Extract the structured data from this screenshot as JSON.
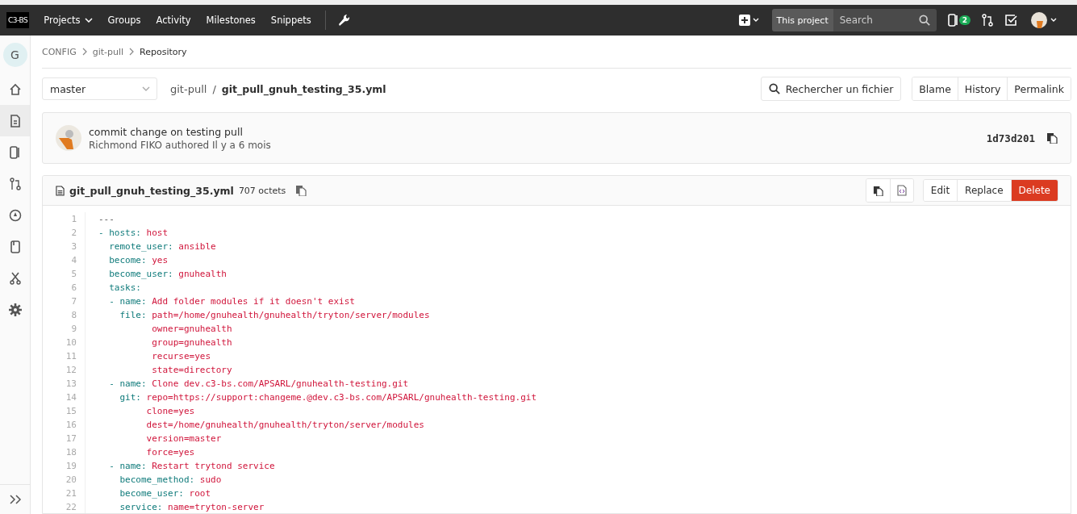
{
  "header": {
    "logo": "C3-BS",
    "nav": [
      {
        "label": "Projects",
        "dropdown": true
      },
      {
        "label": "Groups",
        "dropdown": false
      },
      {
        "label": "Activity",
        "dropdown": false
      },
      {
        "label": "Milestones",
        "dropdown": false
      },
      {
        "label": "Snippets",
        "dropdown": false
      }
    ],
    "search_scope": "This project",
    "search": {
      "placeholder": "Search"
    },
    "issues_badge": "2"
  },
  "sidebar": {
    "avatar": "G",
    "items": [
      {
        "selected": false
      },
      {
        "selected": true
      },
      {
        "selected": false
      },
      {
        "selected": false
      },
      {
        "selected": false
      },
      {
        "selected": false
      },
      {
        "selected": false
      },
      {
        "selected": false
      }
    ]
  },
  "breadcrumbs": [
    {
      "label": "CONFIG",
      "current": false
    },
    {
      "label": "git-pull",
      "current": false
    },
    {
      "label": "Repository",
      "current": true
    }
  ],
  "branch": "master",
  "path": {
    "project": "git-pull",
    "sep": "/",
    "file": "git_pull_gnuh_testing_35.yml"
  },
  "find_file": "Rechercher un fichier",
  "view_buttons": [
    "Blame",
    "History",
    "Permalink"
  ],
  "commit": {
    "message": "commit change on testing pull",
    "author": "Richmond FIKO authored Il y a 6 mois",
    "sha": "1d73d201"
  },
  "file": {
    "name": "git_pull_gnuh_testing_35.yml",
    "size": "707 octets",
    "actions": [
      {
        "label": "Edit",
        "kind": "default"
      },
      {
        "label": "Replace",
        "kind": "default"
      },
      {
        "label": "Delete",
        "kind": "danger"
      }
    ]
  },
  "code": [
    {
      "n": "1",
      "parts": [
        {
          "kind": "plain",
          "text": "---"
        }
      ]
    },
    {
      "n": "2",
      "parts": [
        {
          "kind": "key",
          "text": "- hosts:"
        },
        {
          "kind": "value",
          "text": " host"
        }
      ]
    },
    {
      "n": "3",
      "parts": [
        {
          "kind": "key",
          "text": "  remote_user:"
        },
        {
          "kind": "value",
          "text": " ansible"
        }
      ]
    },
    {
      "n": "4",
      "parts": [
        {
          "kind": "key",
          "text": "  become:"
        },
        {
          "kind": "value",
          "text": " yes"
        }
      ]
    },
    {
      "n": "5",
      "parts": [
        {
          "kind": "key",
          "text": "  become_user:"
        },
        {
          "kind": "value",
          "text": " gnuhealth"
        }
      ]
    },
    {
      "n": "6",
      "parts": [
        {
          "kind": "key",
          "text": "  tasks:"
        }
      ]
    },
    {
      "n": "7",
      "parts": [
        {
          "kind": "key",
          "text": "  - name:"
        },
        {
          "kind": "value",
          "text": " Add folder modules if it doesn't exist"
        }
      ]
    },
    {
      "n": "8",
      "parts": [
        {
          "kind": "key",
          "text": "    file:"
        },
        {
          "kind": "value",
          "text": " path=/home/gnuhealth/gnuhealth/tryton/server/modules"
        }
      ]
    },
    {
      "n": "9",
      "parts": [
        {
          "kind": "value",
          "text": "          owner=gnuhealth"
        }
      ]
    },
    {
      "n": "10",
      "parts": [
        {
          "kind": "value",
          "text": "          group=gnuhealth"
        }
      ]
    },
    {
      "n": "11",
      "parts": [
        {
          "kind": "value",
          "text": "          recurse=yes"
        }
      ]
    },
    {
      "n": "12",
      "parts": [
        {
          "kind": "value",
          "text": "          state=directory"
        }
      ]
    },
    {
      "n": "13",
      "parts": [
        {
          "kind": "key",
          "text": "  - name:"
        },
        {
          "kind": "value",
          "text": " Clone dev.c3-bs.com/APSARL/gnuhealth-testing.git"
        }
      ]
    },
    {
      "n": "14",
      "parts": [
        {
          "kind": "key",
          "text": "    git:"
        },
        {
          "kind": "value",
          "text": " repo=https://support:changeme.@dev.c3-bs.com/APSARL/gnuhealth-testing.git"
        }
      ]
    },
    {
      "n": "15",
      "parts": [
        {
          "kind": "value",
          "text": "         clone=yes"
        }
      ]
    },
    {
      "n": "16",
      "parts": [
        {
          "kind": "value",
          "text": "         dest=/home/gnuhealth/gnuhealth/tryton/server/modules"
        }
      ]
    },
    {
      "n": "17",
      "parts": [
        {
          "kind": "value",
          "text": "         version=master"
        }
      ]
    },
    {
      "n": "18",
      "parts": [
        {
          "kind": "value",
          "text": "         force=yes"
        }
      ]
    },
    {
      "n": "19",
      "parts": [
        {
          "kind": "key",
          "text": "  - name:"
        },
        {
          "kind": "value",
          "text": " Restart trytond service"
        }
      ]
    },
    {
      "n": "20",
      "parts": [
        {
          "kind": "key",
          "text": "    become_method:"
        },
        {
          "kind": "value",
          "text": " sudo"
        }
      ]
    },
    {
      "n": "21",
      "parts": [
        {
          "kind": "key",
          "text": "    become_user:"
        },
        {
          "kind": "value",
          "text": " root"
        }
      ]
    },
    {
      "n": "22",
      "parts": [
        {
          "kind": "key",
          "text": "    service:"
        },
        {
          "kind": "value",
          "text": " name=tryton-server"
        }
      ]
    }
  ]
}
